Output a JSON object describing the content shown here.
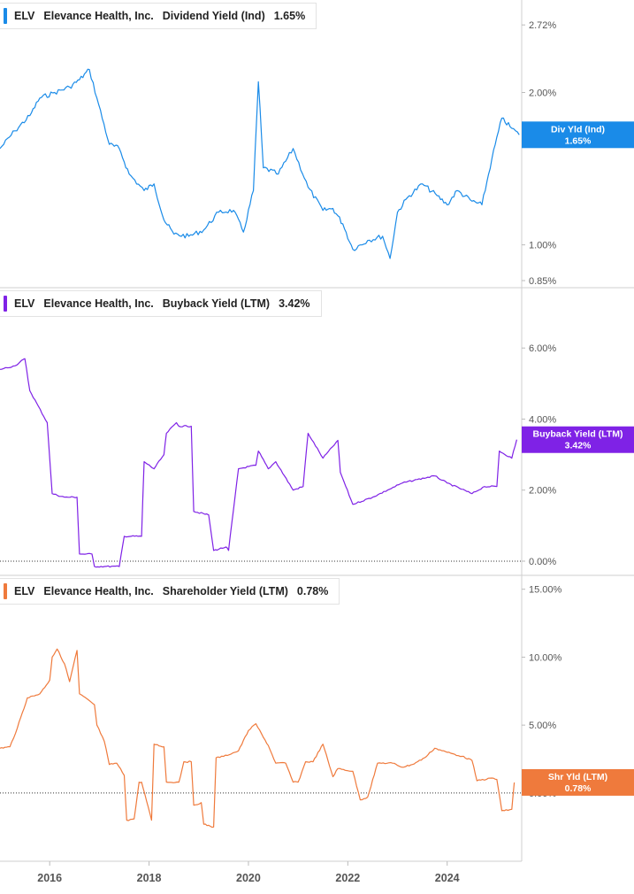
{
  "chart_data": [
    {
      "type": "line",
      "ticker": "ELV",
      "company": "Elevance Health, Inc.",
      "metric": "Dividend Yield (Ind)",
      "current_value": "1.65%",
      "tag_label": "Div Yld (Ind)",
      "color": "#1a8be8",
      "scale": "log",
      "ylim": [
        0.85,
        2.95
      ],
      "yticks": [
        "2.72%",
        "2.00%",
        "1.00%",
        "0.85%"
      ],
      "ytick_values": [
        2.72,
        2.0,
        1.0,
        0.85
      ],
      "dotted_zero": false,
      "x": [
        2015.0,
        2015.3,
        2015.6,
        2015.8,
        2016.1,
        2016.4,
        2016.6,
        2016.8,
        2016.95,
        2017.2,
        2017.4,
        2017.6,
        2017.9,
        2018.1,
        2018.3,
        2018.5,
        2018.8,
        2019.1,
        2019.4,
        2019.7,
        2019.9,
        2020.1,
        2020.2,
        2020.3,
        2020.6,
        2020.9,
        2021.2,
        2021.5,
        2021.7,
        2021.9,
        2022.1,
        2022.4,
        2022.7,
        2022.85,
        2023.0,
        2023.2,
        2023.5,
        2023.8,
        2024.0,
        2024.2,
        2024.5,
        2024.7,
        2024.9,
        2025.1,
        2025.3,
        2025.45
      ],
      "y": [
        1.55,
        1.68,
        1.8,
        1.95,
        2.0,
        2.05,
        2.12,
        2.22,
        1.95,
        1.58,
        1.55,
        1.38,
        1.28,
        1.32,
        1.12,
        1.05,
        1.04,
        1.07,
        1.16,
        1.17,
        1.06,
        1.28,
        2.1,
        1.42,
        1.38,
        1.55,
        1.3,
        1.17,
        1.18,
        1.1,
        0.98,
        1.02,
        1.04,
        0.94,
        1.16,
        1.24,
        1.32,
        1.25,
        1.2,
        1.28,
        1.22,
        1.2,
        1.48,
        1.78,
        1.7,
        1.65
      ]
    },
    {
      "type": "line",
      "ticker": "ELV",
      "company": "Elevance Health, Inc.",
      "metric": "Buyback Yield (LTM)",
      "current_value": "3.42%",
      "tag_label": "Buyback Yield (LTM)",
      "color": "#7f22e6",
      "scale": "linear",
      "ylim": [
        -0.2,
        7.5
      ],
      "yticks": [
        "6.00%",
        "4.00%",
        "2.00%",
        "0.00%"
      ],
      "ytick_values": [
        6.0,
        4.0,
        2.0,
        0.0
      ],
      "dotted_zero": true,
      "x": [
        2015.0,
        2015.3,
        2015.5,
        2015.6,
        2015.95,
        2016.05,
        2016.3,
        2016.55,
        2016.6,
        2016.85,
        2016.9,
        2017.1,
        2017.4,
        2017.5,
        2017.85,
        2017.9,
        2018.1,
        2018.3,
        2018.35,
        2018.55,
        2018.6,
        2018.85,
        2018.9,
        2019.2,
        2019.3,
        2019.55,
        2019.6,
        2019.8,
        2020.15,
        2020.2,
        2020.4,
        2020.55,
        2020.9,
        2021.1,
        2021.2,
        2021.5,
        2021.8,
        2021.85,
        2022.1,
        2022.5,
        2022.8,
        2023.1,
        2023.4,
        2023.75,
        2024.0,
        2024.5,
        2024.75,
        2025.0,
        2025.05,
        2025.3,
        2025.4
      ],
      "y": [
        5.4,
        5.5,
        5.7,
        4.8,
        3.9,
        1.9,
        1.8,
        1.8,
        0.2,
        0.2,
        -0.15,
        -0.15,
        -0.15,
        0.7,
        0.7,
        2.8,
        2.6,
        3.0,
        3.6,
        3.9,
        3.8,
        3.8,
        1.4,
        1.3,
        0.3,
        0.4,
        0.3,
        2.6,
        2.7,
        3.1,
        2.6,
        2.8,
        2.0,
        2.1,
        3.6,
        2.9,
        3.4,
        2.5,
        1.6,
        1.8,
        2.0,
        2.2,
        2.3,
        2.4,
        2.2,
        1.9,
        2.1,
        2.1,
        3.1,
        2.9,
        3.42
      ]
    },
    {
      "type": "line",
      "ticker": "ELV",
      "company": "Elevance Health, Inc.",
      "metric": "Shareholder Yield (LTM)",
      "current_value": "0.78%",
      "tag_label": "Shr Yld (LTM)",
      "color": "#ef7a3c",
      "scale": "linear",
      "ylim": [
        -4.5,
        15.5
      ],
      "yticks": [
        "15.00%",
        "10.00%",
        "5.00%",
        "0.00%"
      ],
      "ytick_values": [
        15.0,
        10.0,
        5.0,
        0.0
      ],
      "dotted_zero": true,
      "x": [
        2015.0,
        2015.2,
        2015.35,
        2015.55,
        2015.8,
        2016.0,
        2016.05,
        2016.15,
        2016.3,
        2016.4,
        2016.55,
        2016.6,
        2016.9,
        2016.95,
        2017.1,
        2017.2,
        2017.35,
        2017.5,
        2017.55,
        2017.7,
        2017.8,
        2017.85,
        2018.05,
        2018.1,
        2018.3,
        2018.35,
        2018.6,
        2018.7,
        2018.85,
        2018.9,
        2019.05,
        2019.1,
        2019.3,
        2019.35,
        2019.5,
        2019.8,
        2020.0,
        2020.15,
        2020.3,
        2020.4,
        2020.55,
        2020.75,
        2020.9,
        2021.0,
        2021.15,
        2021.3,
        2021.5,
        2021.7,
        2021.8,
        2022.1,
        2022.25,
        2022.4,
        2022.6,
        2022.9,
        2023.1,
        2023.3,
        2023.55,
        2023.75,
        2024.0,
        2024.3,
        2024.5,
        2024.6,
        2024.9,
        2025.0,
        2025.1,
        2025.15,
        2025.3,
        2025.35
      ],
      "y": [
        3.3,
        3.4,
        4.8,
        7.0,
        7.3,
        8.3,
        10.0,
        10.6,
        9.5,
        8.2,
        10.5,
        7.3,
        6.5,
        5.0,
        3.8,
        2.1,
        2.2,
        1.3,
        -2.0,
        -1.9,
        0.8,
        0.8,
        -2.0,
        3.6,
        3.4,
        0.8,
        0.8,
        2.3,
        2.3,
        -0.9,
        -0.7,
        -2.3,
        -2.5,
        2.6,
        2.7,
        3.1,
        4.6,
        5.1,
        4.1,
        3.5,
        2.2,
        2.2,
        0.8,
        0.8,
        2.3,
        2.3,
        3.6,
        1.2,
        1.8,
        1.6,
        -0.5,
        -0.3,
        2.2,
        2.2,
        1.9,
        2.1,
        2.6,
        3.3,
        3.0,
        2.7,
        2.4,
        0.9,
        1.1,
        1.0,
        -1.3,
        -1.3,
        -1.2,
        0.78
      ]
    }
  ],
  "xaxis": {
    "tick_labels": [
      "2016",
      "2018",
      "2020",
      "2022",
      "2024"
    ],
    "tick_values": [
      2016,
      2018,
      2020,
      2022,
      2024
    ],
    "xlim": [
      2015.0,
      2025.5
    ]
  }
}
